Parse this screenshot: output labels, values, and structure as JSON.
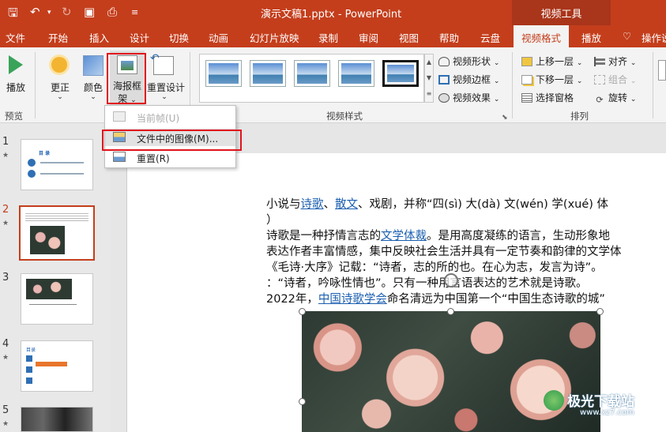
{
  "window": {
    "title": "演示文稿1.pptx  -  PowerPoint",
    "context_tools": "视频工具"
  },
  "tabs": [
    "文件",
    "开始",
    "插入",
    "设计",
    "切换",
    "动画",
    "幻灯片放映",
    "录制",
    "审阅",
    "视图",
    "帮助",
    "云盘",
    "视频格式",
    "播放",
    "操作说"
  ],
  "active_tab": "视频格式",
  "ribbon": {
    "preview": {
      "play": "播放",
      "group": "预览"
    },
    "adjust": {
      "correct": "更正",
      "color": "颜色",
      "poster_line1": "海报框",
      "poster_line2": "架",
      "reset": "重置设计",
      "group": "调"
    },
    "styles": {
      "shape": "视频形状",
      "border": "视频边框",
      "effects": "视频效果",
      "group": "视频样式"
    },
    "arrange": {
      "bring_forward": "上移一层",
      "send_backward": "下移一层",
      "selection_pane": "选择窗格",
      "align": "对齐",
      "group_cmd": "组合",
      "rotate": "旋转",
      "group": "排列"
    }
  },
  "dropdown": {
    "items": [
      {
        "label": "当前帧(U)",
        "enabled": false
      },
      {
        "label": "文件中的图像(M)...",
        "enabled": true
      },
      {
        "label": "重置(R)",
        "enabled": true
      }
    ]
  },
  "slides": [
    {
      "num": "1",
      "star": "★",
      "title": "目      录"
    },
    {
      "num": "2",
      "star": "★"
    },
    {
      "num": "3",
      "star": ""
    },
    {
      "num": "4",
      "star": "★",
      "title": "目录"
    },
    {
      "num": "5",
      "star": "★"
    }
  ],
  "slide_text": {
    "line1_a": "小说与",
    "line1_link1": "诗歌",
    "line1_b": "、",
    "line1_link2": "散文",
    "line1_c": "、戏剧，并称“四(sì) 大(dà) 文(wén) 学(xué) 体",
    "line2": "）",
    "line3_a": "诗歌是一种抒情言志的",
    "line3_link": "文学体裁",
    "line3_b": "。是用高度凝练的语言，生动形象地",
    "line4": "表达作者丰富情感，集中反映社会生活并具有一定节奏和韵律的文学体",
    "line5": "《毛诗·大序》记载：“诗者，志的所的也。在心为志，发言为诗”。",
    "line6": "：“诗者，吟咏性情也”。只有一种用言语表达的艺术就是诗歌。",
    "line7_a": "2022年，",
    "line7_link": "中国诗歌学会",
    "line7_b": "命名清远为中国第一个“中国生态诗歌的城”"
  },
  "watermark": {
    "text": "极光下载站",
    "url": "www.xz7.com"
  },
  "colors": {
    "accent": "#c43e1c",
    "highlight": "#e0141c",
    "link": "#1b5fb0"
  }
}
